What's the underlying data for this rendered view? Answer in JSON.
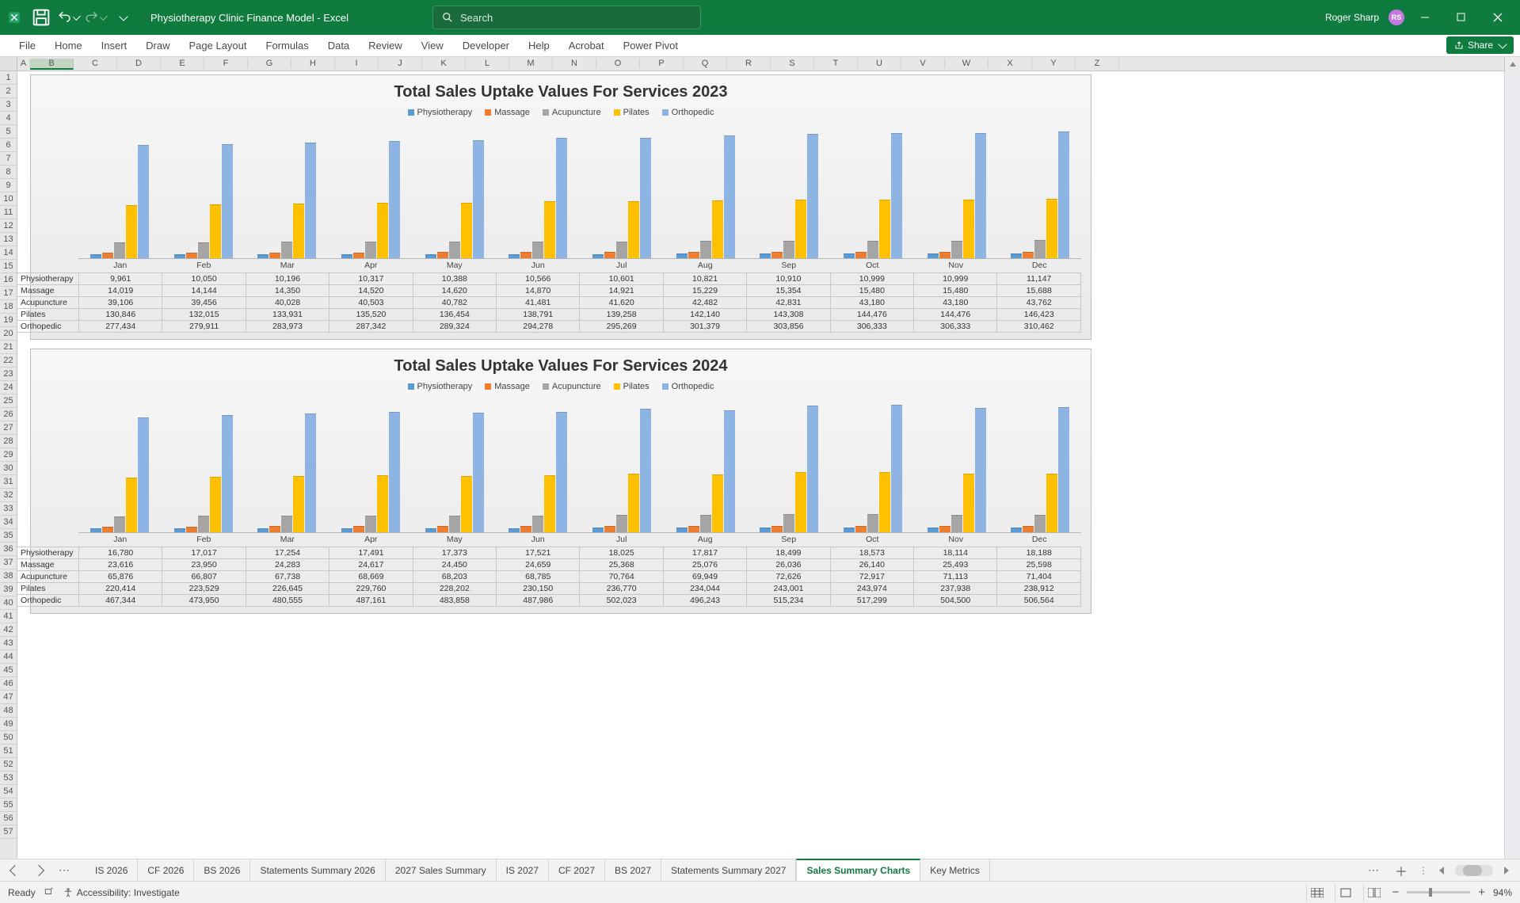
{
  "app": {
    "doc_title": "Physiotherapy Clinic Finance Model  -  Excel",
    "search_placeholder": "Search",
    "user_name": "Roger Sharp",
    "user_initials": "RS",
    "share_label": "Share"
  },
  "ribbon_tabs": [
    "File",
    "Home",
    "Insert",
    "Draw",
    "Page Layout",
    "Formulas",
    "Data",
    "Review",
    "View",
    "Developer",
    "Help",
    "Acrobat",
    "Power Pivot"
  ],
  "columns": [
    "A",
    "B",
    "C",
    "D",
    "E",
    "F",
    "G",
    "H",
    "I",
    "J",
    "K",
    "L",
    "M",
    "N",
    "O",
    "P",
    "Q",
    "R",
    "S",
    "T",
    "U",
    "V",
    "W",
    "X",
    "Y",
    "Z"
  ],
  "row_count_approx": 41,
  "chart_data": [
    {
      "type": "bar",
      "title": "Total Sales Uptake Values For Services 2023",
      "categories": [
        "Jan",
        "Feb",
        "Mar",
        "Apr",
        "May",
        "Jun",
        "Jul",
        "Aug",
        "Sep",
        "Oct",
        "Nov",
        "Dec"
      ],
      "series": [
        {
          "name": "Physiotherapy",
          "color": "#5b9bd5",
          "values": [
            9961,
            10050,
            10196,
            10317,
            10388,
            10566,
            10601,
            10821,
            10910,
            10999,
            10999,
            11147
          ]
        },
        {
          "name": "Massage",
          "color": "#ed7d31",
          "values": [
            14019,
            14144,
            14350,
            14520,
            14620,
            14870,
            14921,
            15229,
            15354,
            15480,
            15480,
            15688
          ]
        },
        {
          "name": "Acupuncture",
          "color": "#a5a5a5",
          "values": [
            39106,
            39456,
            40028,
            40503,
            40782,
            41481,
            41620,
            42482,
            42831,
            43180,
            43180,
            43762
          ]
        },
        {
          "name": "Pilates",
          "color": "#ffc000",
          "values": [
            130846,
            132015,
            133931,
            135520,
            136454,
            138791,
            139258,
            142140,
            143308,
            144476,
            144476,
            146423
          ]
        },
        {
          "name": "Orthopedic",
          "color": "#8eb4e3",
          "values": [
            277434,
            279911,
            283973,
            287342,
            289324,
            294278,
            295269,
            301379,
            303856,
            306333,
            306333,
            310462
          ]
        }
      ],
      "ylim": [
        0,
        320000
      ]
    },
    {
      "type": "bar",
      "title": "Total Sales Uptake Values For Services 2024",
      "categories": [
        "Jan",
        "Feb",
        "Mar",
        "Apr",
        "May",
        "Jun",
        "Jul",
        "Aug",
        "Sep",
        "Oct",
        "Nov",
        "Dec"
      ],
      "series": [
        {
          "name": "Physiotherapy",
          "color": "#5b9bd5",
          "values": [
            16780,
            17017,
            17254,
            17491,
            17373,
            17521,
            18025,
            17817,
            18499,
            18573,
            18114,
            18188
          ]
        },
        {
          "name": "Massage",
          "color": "#ed7d31",
          "values": [
            23616,
            23950,
            24283,
            24617,
            24450,
            24659,
            25368,
            25076,
            26036,
            26140,
            25493,
            25598
          ]
        },
        {
          "name": "Acupuncture",
          "color": "#a5a5a5",
          "values": [
            65876,
            66807,
            67738,
            68669,
            68203,
            68785,
            70764,
            69949,
            72626,
            72917,
            71113,
            71404
          ]
        },
        {
          "name": "Pilates",
          "color": "#ffc000",
          "values": [
            220414,
            223529,
            226645,
            229760,
            228202,
            230150,
            236770,
            234044,
            243001,
            243974,
            237938,
            238912
          ]
        },
        {
          "name": "Orthopedic",
          "color": "#8eb4e3",
          "values": [
            467344,
            473950,
            480555,
            487161,
            483858,
            487986,
            502023,
            496243,
            515234,
            517299,
            504500,
            506564
          ]
        }
      ],
      "ylim": [
        0,
        530000
      ]
    }
  ],
  "sheet_tabs": [
    "IS 2026",
    "CF 2026",
    "BS 2026",
    "Statements Summary 2026",
    "2027 Sales Summary",
    "IS 2027",
    "CF 2027",
    "BS 2027",
    "Statements Summary 2027",
    "Sales Summary Charts",
    "Key Metrics"
  ],
  "active_tab": "Sales Summary Charts",
  "status": {
    "ready": "Ready",
    "accessibility": "Accessibility: Investigate",
    "zoom": "94%"
  }
}
